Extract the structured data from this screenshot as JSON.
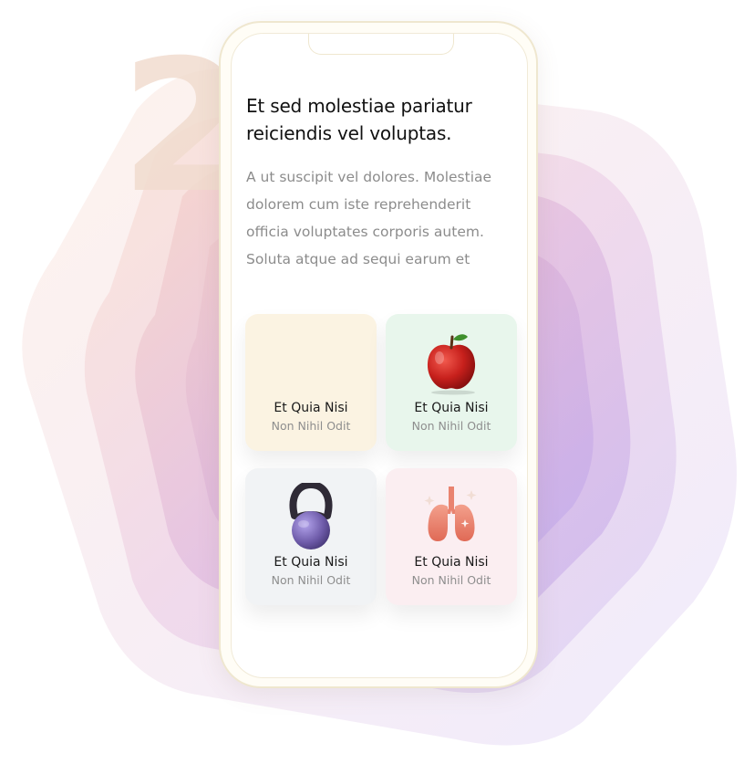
{
  "background": {
    "step_number": "2",
    "colors": {
      "number": "#f1dccf",
      "outer_shape": "#f6eef4",
      "mid_shape": "#ead6ea",
      "inner_shape": "#d9bde6",
      "accent_purple": "#b9a4ee",
      "accent_peach": "#fae2d2"
    }
  },
  "phone": {
    "frame_color": "#efe7cf",
    "headline": "Et sed molestiae pariatur\n reiciendis vel  voluptas.",
    "body": "A ut suscipit vel dolores. Molestiae\ndolorem cum iste reprehenderit\nofficia voluptates corporis autem.\nSoluta atque ad sequi earum et",
    "cards": [
      {
        "title": "Et Quia Nisi",
        "subtitle": "Non Nihil Odit",
        "icon": "none",
        "color": "#fbf3e2"
      },
      {
        "title": "Et Quia Nisi",
        "subtitle": "Non Nihil Odit",
        "icon": "apple-icon",
        "color": "#e8f6ec"
      },
      {
        "title": "Et Quia Nisi",
        "subtitle": "Non Nihil Odit",
        "icon": "kettlebell-icon",
        "color": "#f1f3f5"
      },
      {
        "title": "Et Quia Nisi",
        "subtitle": "Non Nihil Odit",
        "icon": "lungs-icon",
        "color": "#fbeef1"
      }
    ]
  }
}
